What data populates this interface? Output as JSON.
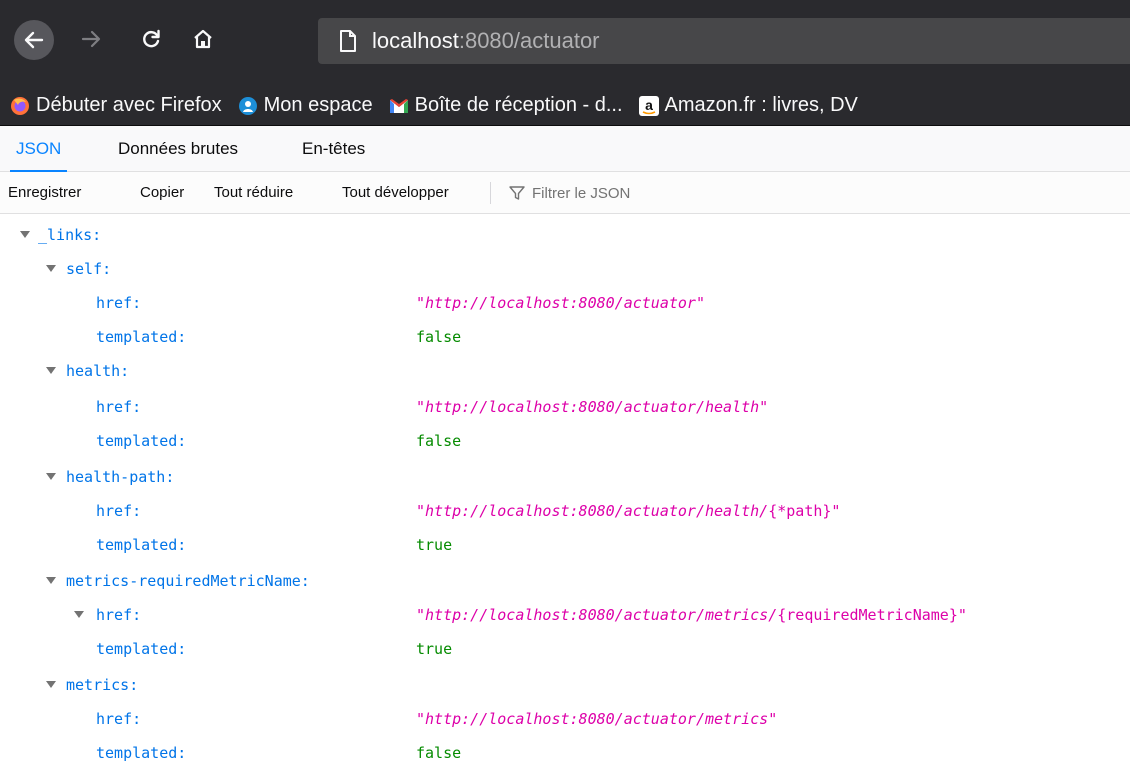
{
  "browser": {
    "url_host": "localhost",
    "url_rest": ":8080/actuator",
    "bookmarks": [
      {
        "label": "Débuter avec Firefox",
        "icon": "firefox-icon"
      },
      {
        "label": "Mon espace",
        "icon": "mon-espace-icon"
      },
      {
        "label": "Boîte de réception - d...",
        "icon": "gmail-icon"
      },
      {
        "label": "Amazon.fr : livres, DV",
        "icon": "amazon-icon"
      }
    ]
  },
  "viewer": {
    "tabs": {
      "json": "JSON",
      "raw": "Données brutes",
      "headers": "En-têtes"
    },
    "toolbar": {
      "save": "Enregistrer",
      "copy": "Copier",
      "collapse": "Tout réduire",
      "expand": "Tout développer",
      "filter_placeholder": "Filtrer le JSON"
    }
  },
  "json": {
    "links_key": "_links:",
    "self_key": "self:",
    "self_href_key": "href:",
    "self_href_val": "http://localhost:8080/actuator",
    "self_templated_key": "templated:",
    "self_templated_val": "false",
    "health_key": "health:",
    "health_href_key": "href:",
    "health_href_val": "http://localhost:8080/actuator/health",
    "health_templated_key": "templated:",
    "health_templated_val": "false",
    "healthpath_key": "health-path:",
    "healthpath_href_key": "href:",
    "healthpath_href_val": "http://localhost:8080/actuator/health/",
    "healthpath_href_tail": "{*path}",
    "healthpath_templated_key": "templated:",
    "healthpath_templated_val": "true",
    "mrm_key": "metrics-requiredMetricName:",
    "mrm_href_key": "href:",
    "mrm_href_val": "http://localhost:8080/actuator/metrics/",
    "mrm_href_tail": "{requiredMetricName}",
    "mrm_templated_key": "templated:",
    "mrm_templated_val": "true",
    "metrics_key": "metrics:",
    "metrics_href_key": "href:",
    "metrics_href_val": "http://localhost:8080/actuator/metrics",
    "metrics_templated_key": "templated:",
    "metrics_templated_val": "false"
  }
}
